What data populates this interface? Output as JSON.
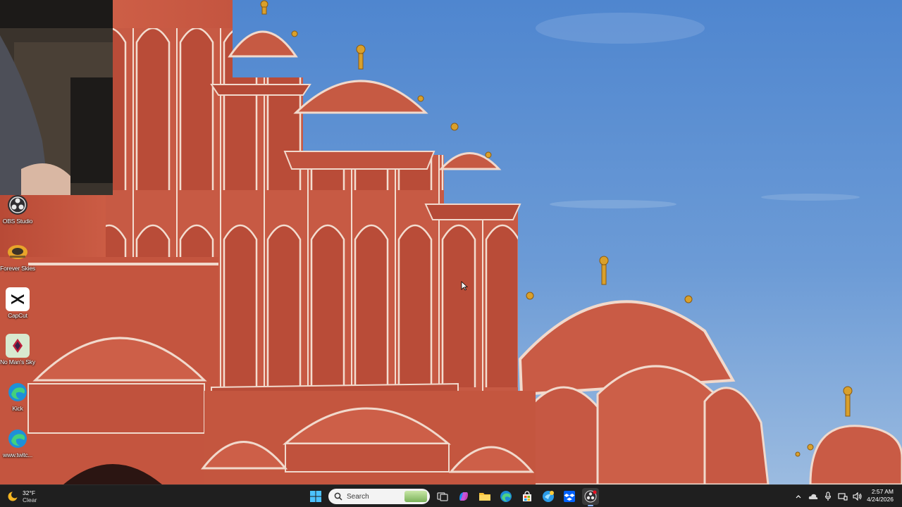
{
  "desktop": {
    "icons": [
      {
        "label": "OBS Studio",
        "icon": "obs-icon"
      },
      {
        "label": "Forever Skies",
        "icon": "forever-skies-icon"
      },
      {
        "label": "CapCut",
        "icon": "capcut-icon"
      },
      {
        "label": "No Man's Sky",
        "icon": "no-mans-sky-icon"
      },
      {
        "label": "Kick",
        "icon": "edge-shortcut-icon"
      },
      {
        "label": "www.twitc...",
        "icon": "edge-shortcut-icon"
      }
    ]
  },
  "taskbar": {
    "weather": {
      "temp": "32°F",
      "condition": "Clear"
    },
    "search": {
      "placeholder": "Search"
    },
    "apps": [
      {
        "name": "start",
        "icon": "windows-icon"
      },
      {
        "name": "task-view",
        "icon": "task-view-icon"
      },
      {
        "name": "copilot",
        "icon": "copilot-icon"
      },
      {
        "name": "file-explorer",
        "icon": "folder-icon"
      },
      {
        "name": "edge",
        "icon": "edge-icon"
      },
      {
        "name": "store",
        "icon": "store-icon"
      },
      {
        "name": "app-blue",
        "icon": "app-icon"
      },
      {
        "name": "dropbox",
        "icon": "dropbox-icon"
      },
      {
        "name": "obs",
        "icon": "obs-icon"
      }
    ],
    "clock": {
      "time": "2:57 AM",
      "date": "4/24/2026"
    }
  },
  "colors": {
    "sky": "#5b8fd0",
    "palace": "#c95a44",
    "trim": "#f1d9cc",
    "taskbar": "#1f1f1f"
  }
}
